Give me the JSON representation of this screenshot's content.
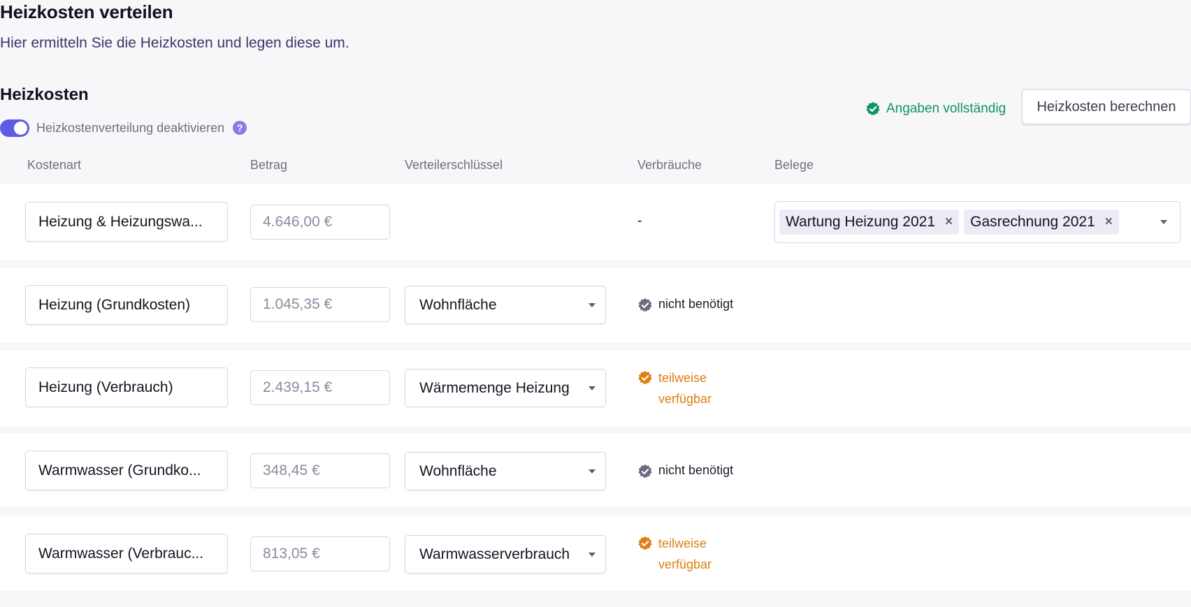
{
  "page": {
    "title": "Heizkosten verteilen",
    "subtitle": "Hier ermitteln Sie die Heizkosten und legen diese um."
  },
  "section": {
    "title": "Heizkosten",
    "toggle_label": "Heizkostenverteilung deaktivieren",
    "toggle_on": true,
    "help_icon": "?",
    "status_text": "Angaben vollständig",
    "calc_button_label": "Heizkosten berechnen"
  },
  "columns": [
    "Kostenart",
    "Betrag",
    "Verteilerschlüssel",
    "Verbräuche",
    "Belege"
  ],
  "rows": [
    {
      "kostenart": "Heizung & Heizungswa...",
      "betrag": "4.646,00 €",
      "verbrauch": "-",
      "belege": [
        "Wartung Heizung 2021",
        "Gasrechnung 2021"
      ]
    },
    {
      "kostenart": "Heizung (Grundkosten)",
      "betrag": "1.045,35 €",
      "schluessel": "Wohnfläche",
      "verbrauch": "nicht benötigt",
      "status": "grey"
    },
    {
      "kostenart": "Heizung (Verbrauch)",
      "betrag": "2.439,15 €",
      "schluessel": "Wärmemenge Heizung",
      "verbrauch": "teilweise\nverfügbar",
      "status": "orange"
    },
    {
      "kostenart": "Warmwasser (Grundko...",
      "betrag": "348,45 €",
      "schluessel": "Wohnfläche",
      "verbrauch": "nicht benötigt",
      "status": "grey"
    },
    {
      "kostenart": "Warmwasser (Verbrauc...",
      "betrag": "813,05 €",
      "schluessel": "Warmwasserverbrauch",
      "verbrauch": "teilweise\nverfügbar",
      "status": "orange"
    }
  ],
  "colors": {
    "accent": "#5b5be6",
    "success": "#0e9461",
    "warning": "#de7f12",
    "neutral_badge": "#6b6b80"
  },
  "icons": {
    "toggle": "toggle-switch",
    "help": "question-circle-icon",
    "verified": "verified-badge-icon",
    "remove": "close-icon",
    "dropdown": "chevron-down-icon"
  }
}
